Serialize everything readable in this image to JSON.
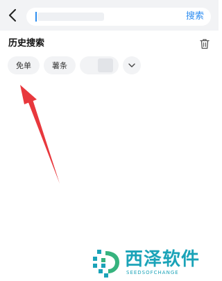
{
  "search": {
    "button_label": "搜索"
  },
  "history": {
    "title": "历史搜索",
    "chips": [
      {
        "label": "免单"
      },
      {
        "label": "薯条"
      }
    ]
  },
  "watermark": {
    "title": "西泽软件",
    "subtitle": "SEEDSOFCHANGE"
  },
  "colors": {
    "accent": "#2d8cf0",
    "arrow": "#e8383d",
    "chip_bg": "#f2f3f5",
    "watermark": "#1aa3b8"
  },
  "icons": {
    "back": "chevron-left-icon",
    "trash": "trash-icon",
    "more": "chevron-down-icon"
  }
}
